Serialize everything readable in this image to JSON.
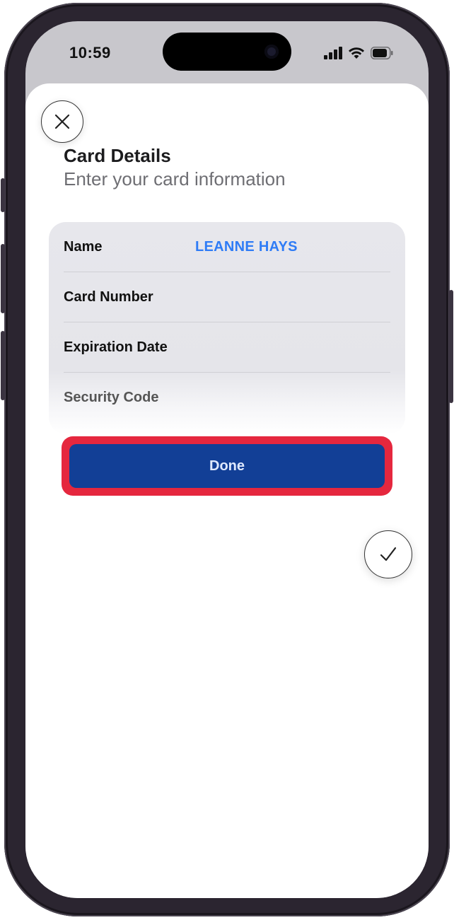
{
  "status_bar": {
    "time": "10:59",
    "icons": [
      "cellular-signal-icon",
      "wifi-icon",
      "battery-icon"
    ]
  },
  "sheet": {
    "close_icon": "close-icon",
    "title": "Card Details",
    "subtitle": "Enter your card information"
  },
  "form": {
    "rows": [
      {
        "label": "Name",
        "value": "LEANNE HAYS"
      },
      {
        "label": "Card Number",
        "value": ""
      },
      {
        "label": "Expiration Date",
        "value": ""
      },
      {
        "label": "Security Code",
        "value": ""
      }
    ]
  },
  "actions": {
    "done_label": "Done",
    "confirm_icon": "checkmark-icon"
  },
  "colors": {
    "done_button": "#123f96",
    "highlight": "#e5273e",
    "value_text": "#2f7cf6"
  }
}
